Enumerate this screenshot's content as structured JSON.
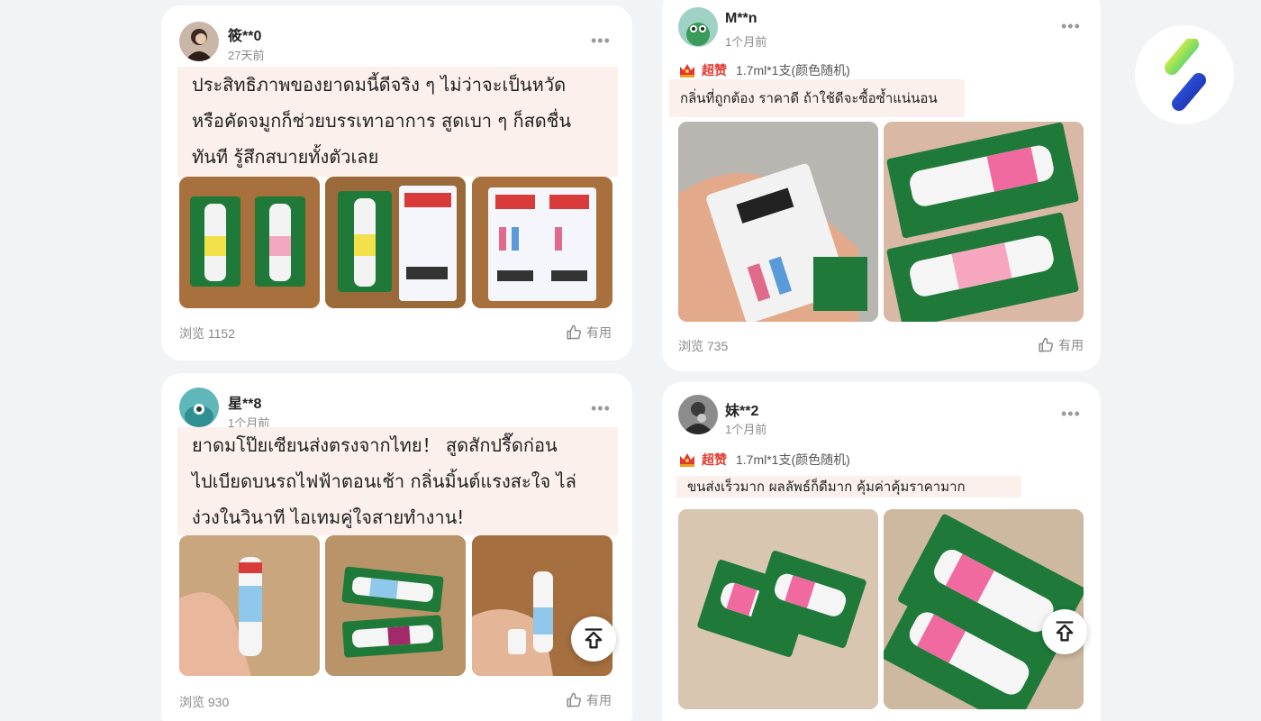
{
  "colors": {
    "accent": "#e2382f",
    "review_bg": "#fbf0ec",
    "page_bg": "#f2f3f5"
  },
  "left": {
    "r1": {
      "user": "筱**0",
      "time": "27天前",
      "text_lines": [
        "ประสิทธิภาพของยาดมนี้ดีจริง ๆ ไม่ว่าจะเป็นหวัด",
        "หรือคัดจมูกก็ช่วยบรรเทาอาการ สูดเบา ๆ ก็สดชื่น",
        "ทันที รู้สึกสบายทั้งตัวเลย"
      ],
      "views": "浏览 1152",
      "useful": "有用"
    },
    "r2": {
      "user": "星**8",
      "time": "1个月前",
      "text_lines": [
        "ยาดมโป๊ยเซียนส่งตรงจากไทย！  สูดสักปรื๊ดก่อน",
        "ไปเบียดบนรถไฟฟ้าตอนเช้า กลิ่นมิ้นต์แรงสะใจ ไล่",
        "ง่วงในวินาที ไอเทมคู่ใจสายทำงาน!"
      ],
      "views": "浏览 930",
      "useful": "有用"
    }
  },
  "right": {
    "r1": {
      "user": "M**n",
      "time": "1个月前",
      "badge": "超赞",
      "spec": "1.7ml*1支(颜色随机)",
      "text": "กลิ่นที่ถูกต้อง ราคาดี ถ้าใช้ดีจะซื้อซ้ำแน่นอน",
      "views": "浏览 735",
      "useful": "有用"
    },
    "r2": {
      "user": "妹**2",
      "time": "1个月前",
      "badge": "超赞",
      "spec": "1.7ml*1支(颜色随机)",
      "text": "ขนส่งเร็วมาก ผลลัพธ์ก็ดีมาก คุ้มค่าคุ้มราคามาก"
    }
  },
  "icons": [
    "more-options-icon",
    "thumbs-up-icon",
    "scroll-to-top-icon",
    "crown-badge-icon",
    "app-logo-icon"
  ]
}
